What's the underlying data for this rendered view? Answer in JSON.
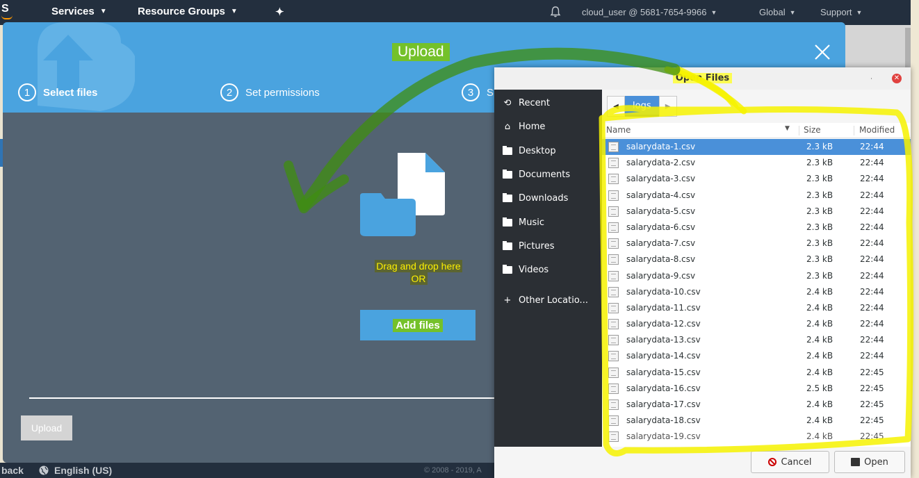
{
  "navbar": {
    "logo_text": "S",
    "services": "Services",
    "resource_groups": "Resource Groups",
    "account": "cloud_user @ 5681-7654-9966",
    "region": "Global",
    "support": "Support",
    "chevron": "⌄",
    "pin": "✦"
  },
  "modal": {
    "title": "Upload",
    "close": "✕",
    "steps": [
      {
        "num": "1",
        "label": "Select files"
      },
      {
        "num": "2",
        "label": "Set permissions"
      },
      {
        "num": "3",
        "label": "S"
      }
    ],
    "drop_line1": "Drag and drop here",
    "drop_line2": "OR",
    "add_files": "Add files",
    "upload_button": "Upload"
  },
  "footer": {
    "feedback": "back",
    "language": "English (US)",
    "copyright": "© 2008 - 2019, A"
  },
  "dialog": {
    "title": "Open Files",
    "places": [
      {
        "icon": "recent-icon",
        "label": "Recent"
      },
      {
        "icon": "home-icon",
        "label": "Home"
      },
      {
        "icon": "folder-icon",
        "label": "Desktop"
      },
      {
        "icon": "folder-icon",
        "label": "Documents"
      },
      {
        "icon": "folder-icon",
        "label": "Downloads"
      },
      {
        "icon": "folder-icon",
        "label": "Music"
      },
      {
        "icon": "folder-icon",
        "label": "Pictures"
      },
      {
        "icon": "folder-icon",
        "label": "Videos"
      },
      {
        "icon": "plus-icon",
        "label": "Other Locatio..."
      }
    ],
    "path_crumb": "logs",
    "columns": {
      "name": "Name",
      "size": "Size",
      "modified": "Modified"
    },
    "files": [
      {
        "name": "salarydata-1.csv",
        "size": "2.3 kB",
        "modified": "22:44"
      },
      {
        "name": "salarydata-2.csv",
        "size": "2.3 kB",
        "modified": "22:44"
      },
      {
        "name": "salarydata-3.csv",
        "size": "2.3 kB",
        "modified": "22:44"
      },
      {
        "name": "salarydata-4.csv",
        "size": "2.3 kB",
        "modified": "22:44"
      },
      {
        "name": "salarydata-5.csv",
        "size": "2.3 kB",
        "modified": "22:44"
      },
      {
        "name": "salarydata-6.csv",
        "size": "2.3 kB",
        "modified": "22:44"
      },
      {
        "name": "salarydata-7.csv",
        "size": "2.3 kB",
        "modified": "22:44"
      },
      {
        "name": "salarydata-8.csv",
        "size": "2.3 kB",
        "modified": "22:44"
      },
      {
        "name": "salarydata-9.csv",
        "size": "2.3 kB",
        "modified": "22:44"
      },
      {
        "name": "salarydata-10.csv",
        "size": "2.4 kB",
        "modified": "22:44"
      },
      {
        "name": "salarydata-11.csv",
        "size": "2.4 kB",
        "modified": "22:44"
      },
      {
        "name": "salarydata-12.csv",
        "size": "2.4 kB",
        "modified": "22:44"
      },
      {
        "name": "salarydata-13.csv",
        "size": "2.4 kB",
        "modified": "22:44"
      },
      {
        "name": "salarydata-14.csv",
        "size": "2.4 kB",
        "modified": "22:44"
      },
      {
        "name": "salarydata-15.csv",
        "size": "2.4 kB",
        "modified": "22:45"
      },
      {
        "name": "salarydata-16.csv",
        "size": "2.5 kB",
        "modified": "22:45"
      },
      {
        "name": "salarydata-17.csv",
        "size": "2.4 kB",
        "modified": "22:45"
      },
      {
        "name": "salarydata-18.csv",
        "size": "2.4 kB",
        "modified": "22:45"
      },
      {
        "name": "salarydata-19.csv",
        "size": "2.4 kB",
        "modified": "22:45"
      }
    ],
    "selected_index": 0,
    "cancel": "Cancel",
    "open": "Open"
  },
  "colors": {
    "aws_nav": "#232f3e",
    "modal_header": "#4aa3df",
    "modal_body": "#536372",
    "selection": "#4a90d9",
    "highlight_yellow": "#fcfc52",
    "annotation_green": "#5aa81c"
  }
}
